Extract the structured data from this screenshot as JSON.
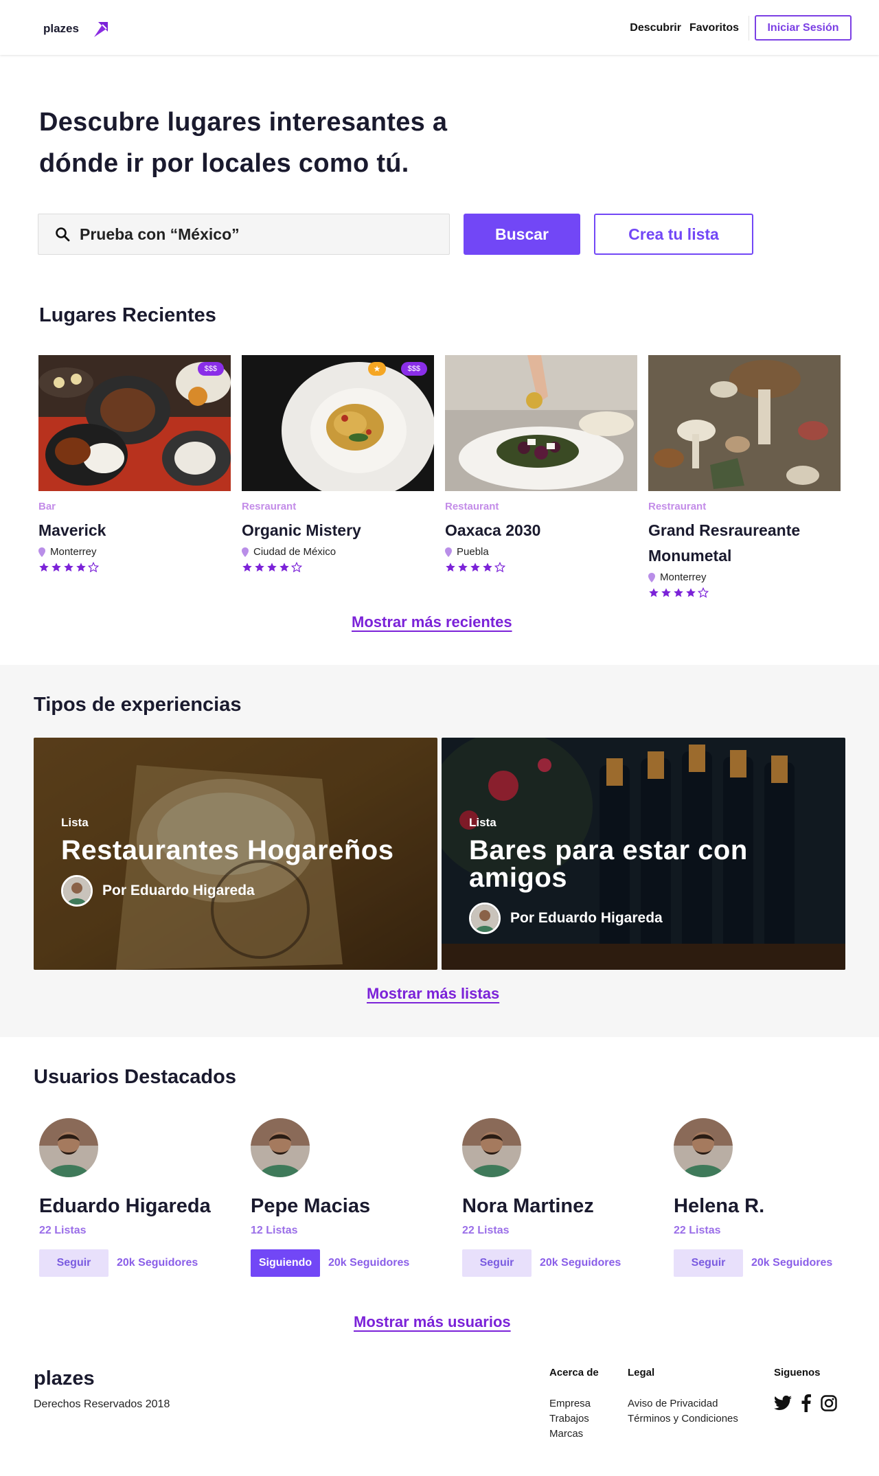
{
  "header": {
    "logo_text": "plazes",
    "nav": [
      {
        "label": "Descubrir"
      },
      {
        "label": "Favoritos"
      }
    ],
    "login_label": "Iniciar Sesión"
  },
  "hero": {
    "title": "Descubre lugares interesantes a dónde ir por locales como tú.",
    "search_placeholder": "Prueba con “México”",
    "search_button": "Buscar",
    "create_button": "Crea tu lista"
  },
  "recent": {
    "title": "Lugares Recientes",
    "more_link": "Mostrar más recientes",
    "places": [
      {
        "category": "Bar",
        "name": "Maverick",
        "location": "Monterrey",
        "rating": 4,
        "price": "$$$",
        "featured": false
      },
      {
        "category": "Resraurant",
        "name": "Organic Mistery",
        "location": "Ciudad de México",
        "rating": 4,
        "price": "$$$",
        "featured": true
      },
      {
        "category": "Restaurant",
        "name": "Oaxaca 2030",
        "location": "Puebla",
        "rating": 4,
        "price": "",
        "featured": false
      },
      {
        "category": "Restraurant",
        "name": "Grand Resraureante Monumetal",
        "location": "Monterrey",
        "rating": 4,
        "price": "",
        "featured": false
      }
    ]
  },
  "experiences": {
    "title": "Tipos de experiencias",
    "more_link": "Mostrar más listas",
    "lists": [
      {
        "tag": "Lista",
        "title": "Restaurantes Hogareños",
        "author": "Por Eduardo Higareda"
      },
      {
        "tag": "Lista",
        "title": "Bares para estar con amigos",
        "author": "Por Eduardo Higareda"
      }
    ]
  },
  "users": {
    "title": "Usuarios Destacados",
    "more_link": "Mostrar más usuarios",
    "items": [
      {
        "name": "Eduardo Higareda",
        "lists": "22 Listas",
        "button": "Seguir",
        "following": false,
        "followers": "20k Seguidores"
      },
      {
        "name": "Pepe Macias",
        "lists": "12 Listas",
        "button": "Siguiendo",
        "following": true,
        "followers": "20k Seguidores"
      },
      {
        "name": "Nora Martinez",
        "lists": "22 Listas",
        "button": "Seguir",
        "following": false,
        "followers": "20k Seguidores"
      },
      {
        "name": "Helena R.",
        "lists": "22 Listas",
        "button": "Seguir",
        "following": false,
        "followers": "20k Seguidores"
      }
    ]
  },
  "footer": {
    "logo": "plazes",
    "copyright": "Derechos Reservados 2018",
    "columns": [
      {
        "title": "Acerca de",
        "links": [
          "Empresa",
          "Trabajos",
          "Marcas"
        ]
      },
      {
        "title": "Legal",
        "links": [
          "Aviso de Privacidad",
          "Términos y Condiciones"
        ]
      },
      {
        "title": "Siguenos",
        "links": []
      }
    ],
    "social_icons": [
      "twitter-icon",
      "facebook-icon",
      "instagram-icon"
    ]
  },
  "colors": {
    "brand": "#7247f6",
    "link": "#7b22d8",
    "category": "#c38ce8"
  }
}
